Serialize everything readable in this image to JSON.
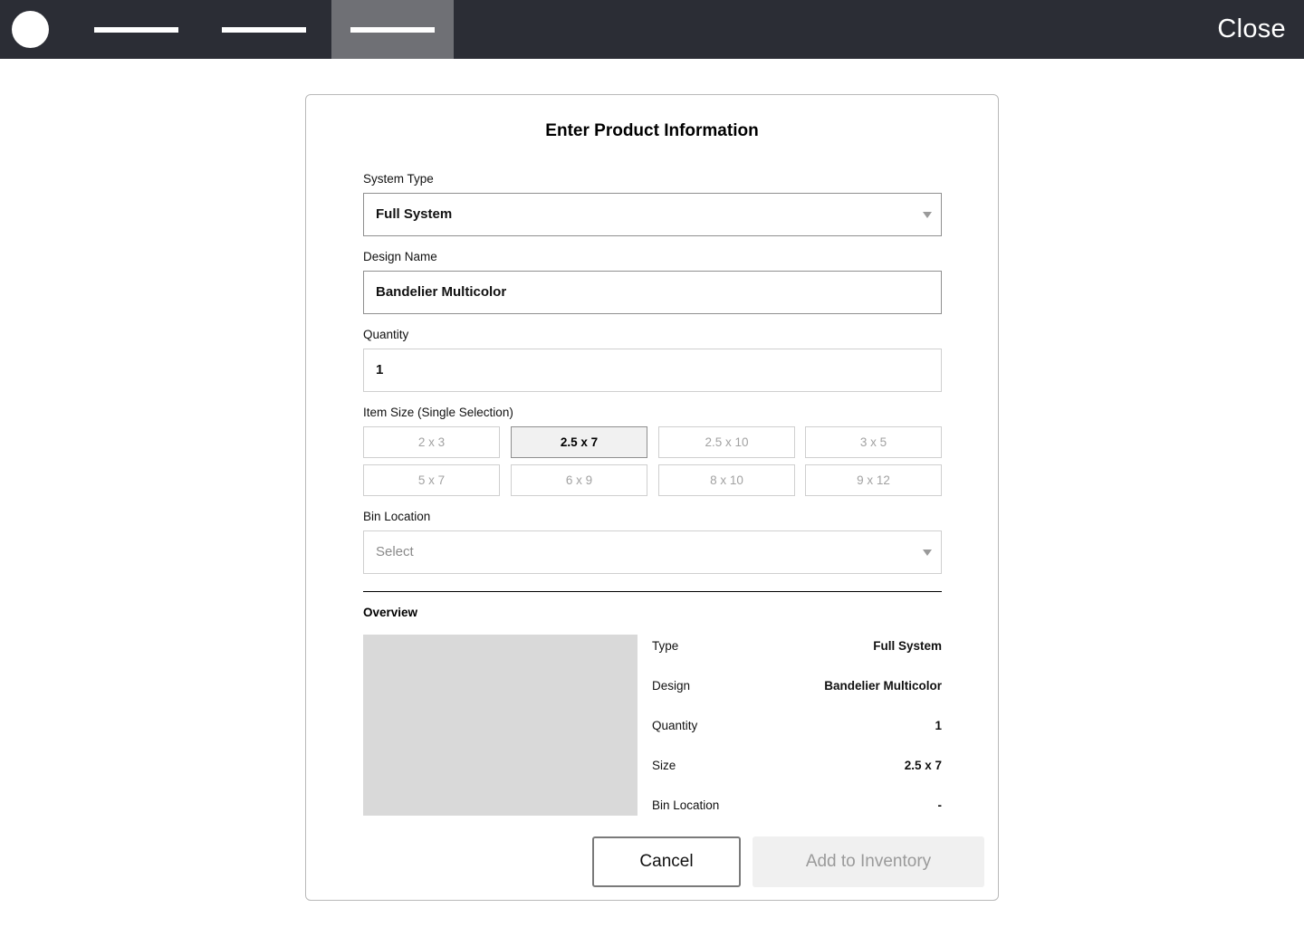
{
  "topbar": {
    "close_label": "Close"
  },
  "modal": {
    "title": "Enter Product Information",
    "system_type": {
      "label": "System Type",
      "value": "Full System"
    },
    "design_name": {
      "label": "Design Name",
      "value": "Bandelier Multicolor"
    },
    "quantity": {
      "label": "Quantity",
      "value": "1"
    },
    "item_size": {
      "label": "Item Size (Single Selection)",
      "options": [
        "2 x 3",
        "2.5 x 7",
        "2.5 x 10",
        "3 x 5",
        "5 x 7",
        "6 x 9",
        "8 x 10",
        "9 x 12"
      ],
      "selected": "2.5 x 7"
    },
    "bin_location": {
      "label": "Bin Location",
      "placeholder": "Select"
    },
    "overview": {
      "title": "Overview",
      "rows": [
        {
          "label": "Type",
          "value": "Full System"
        },
        {
          "label": "Design",
          "value": "Bandelier Multicolor"
        },
        {
          "label": "Quantity",
          "value": "1"
        },
        {
          "label": "Size",
          "value": "2.5 x 7"
        },
        {
          "label": "Bin Location",
          "value": "-"
        }
      ]
    },
    "cancel_label": "Cancel",
    "add_label": "Add to Inventory"
  },
  "colors": {
    "topbar_bg": "#2b2d35",
    "active_tab_bg": "#6f7075",
    "preview_placeholder": "#d9d9d9",
    "disabled_button_bg": "#f0f0f0"
  }
}
